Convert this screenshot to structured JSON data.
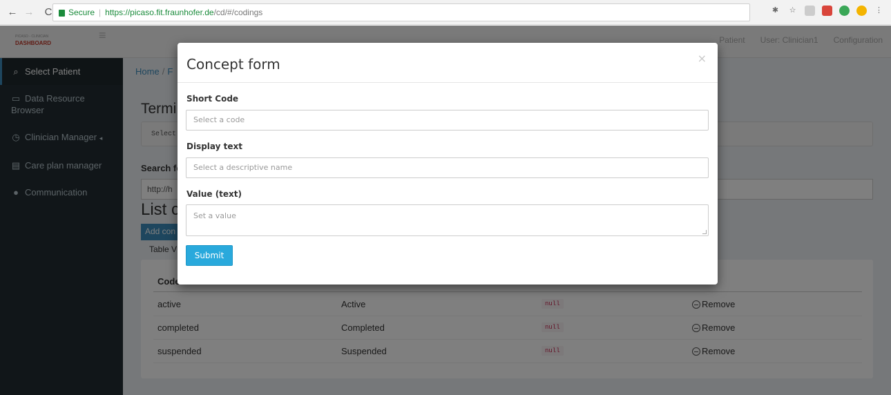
{
  "browser": {
    "secure_label": "Secure",
    "url_host": "https://picaso.fit.fraunhofer.de",
    "url_path": "/cd/#/codings",
    "icons": [
      "back-icon",
      "forward-icon",
      "reload-icon",
      "lock-icon",
      "star-icon"
    ]
  },
  "topbar": {
    "logo_sub": "PICASO - CLINICIAN",
    "logo_main": "DASHBOARD",
    "patient": "Patient",
    "user": "User: Clinician1",
    "configuration": "Configuration"
  },
  "sidebar": {
    "items": [
      {
        "label": "Select Patient",
        "icon": "search-icon"
      },
      {
        "label": "Data Resource Browser",
        "icon": "folder-icon"
      },
      {
        "label": "Clinician Manager",
        "icon": "clock-icon"
      },
      {
        "label": "Care plan manager",
        "icon": "calendar-icon"
      },
      {
        "label": "Communication",
        "icon": "chat-icon"
      }
    ]
  },
  "content": {
    "breadcrumb_home": "Home",
    "breadcrumb_sep": "/",
    "breadcrumb_current": "F",
    "heading_terminology": "Termi",
    "select_text": "Select",
    "search_label": "Search fo",
    "search_value": "http://h",
    "heading_list": "List c",
    "add_button": "Add con",
    "tabs_text": "Table V",
    "table_header_code": "Code",
    "rows": [
      {
        "code": "active",
        "display": "Active",
        "value": "null",
        "action": "Remove"
      },
      {
        "code": "completed",
        "display": "Completed",
        "value": "null",
        "action": "Remove"
      },
      {
        "code": "suspended",
        "display": "Suspended",
        "value": "null",
        "action": "Remove"
      }
    ]
  },
  "modal": {
    "title": "Concept form",
    "close": "×",
    "short_code_label": "Short Code",
    "short_code_placeholder": "Select a code",
    "display_text_label": "Display text",
    "display_text_placeholder": "Select a descriptive name",
    "value_label": "Value (text)",
    "value_placeholder": "Set a value",
    "submit": "Submit"
  },
  "colors": {
    "submit": "#29a9dc",
    "sidebar": "#222d32",
    "link": "#3c8dbc"
  }
}
